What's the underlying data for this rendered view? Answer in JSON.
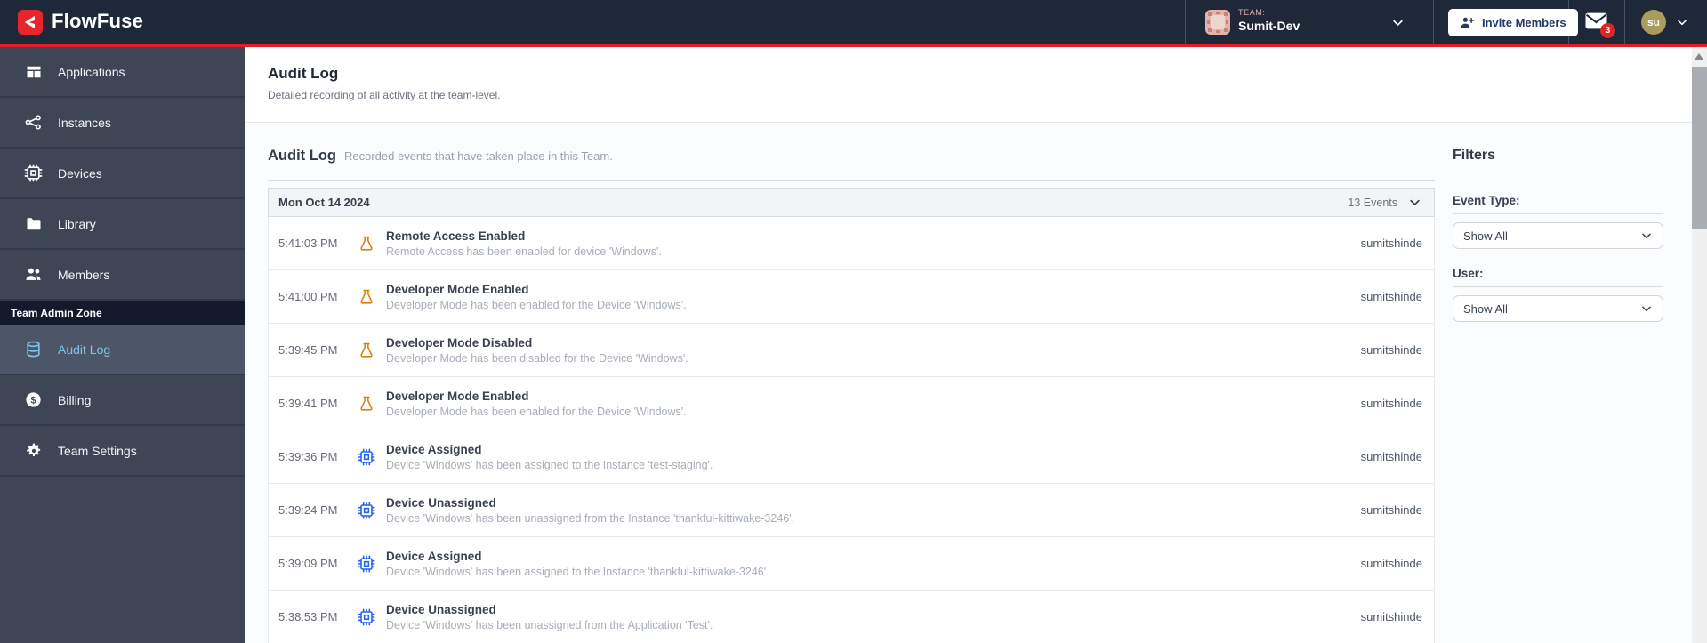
{
  "nav": {
    "brand": "FlowFuse",
    "team_eyebrow": "TEAM:",
    "team_name": "Sumit-Dev",
    "invite_button_label": "Invite Members",
    "mail_badge_count": "3",
    "user_initials": "su"
  },
  "sidebar": {
    "items": [
      {
        "label": "Applications",
        "icon": "applications-icon"
      },
      {
        "label": "Instances",
        "icon": "instances-icon"
      },
      {
        "label": "Devices",
        "icon": "devices-icon"
      },
      {
        "label": "Library",
        "icon": "library-icon"
      },
      {
        "label": "Members",
        "icon": "members-icon"
      }
    ],
    "admin_zone_label": "Team Admin Zone",
    "admin_items": [
      {
        "label": "Audit Log",
        "icon": "audit-log-icon",
        "active": true
      },
      {
        "label": "Billing",
        "icon": "billing-icon",
        "active": false
      },
      {
        "label": "Team Settings",
        "icon": "gear-icon",
        "active": false
      }
    ]
  },
  "page": {
    "title": "Audit Log",
    "subtitle": "Detailed recording of all activity at the team-level."
  },
  "section": {
    "title": "Audit Log",
    "subtitle": "Recorded events that have taken place in this Team."
  },
  "log_group": {
    "date": "Mon Oct 14 2024",
    "events_count": "13 Events"
  },
  "events": [
    {
      "time": "5:41:03 PM",
      "icon": "flask",
      "title": "Remote Access Enabled",
      "desc": "Remote Access has been enabled for device 'Windows'.",
      "user": "sumitshinde"
    },
    {
      "time": "5:41:00 PM",
      "icon": "flask",
      "title": "Developer Mode Enabled",
      "desc": "Developer Mode has been enabled for the Device 'Windows'.",
      "user": "sumitshinde"
    },
    {
      "time": "5:39:45 PM",
      "icon": "flask",
      "title": "Developer Mode Disabled",
      "desc": "Developer Mode has been disabled for the Device 'Windows'.",
      "user": "sumitshinde"
    },
    {
      "time": "5:39:41 PM",
      "icon": "flask",
      "title": "Developer Mode Enabled",
      "desc": "Developer Mode has been enabled for the Device 'Windows'.",
      "user": "sumitshinde"
    },
    {
      "time": "5:39:36 PM",
      "icon": "chip",
      "title": "Device Assigned",
      "desc": "Device 'Windows' has been assigned to the Instance 'test-staging'.",
      "user": "sumitshinde"
    },
    {
      "time": "5:39:24 PM",
      "icon": "chip",
      "title": "Device Unassigned",
      "desc": "Device 'Windows' has been unassigned from the Instance 'thankful-kittiwake-3246'.",
      "user": "sumitshinde"
    },
    {
      "time": "5:39:09 PM",
      "icon": "chip",
      "title": "Device Assigned",
      "desc": "Device 'Windows' has been assigned to the Instance 'thankful-kittiwake-3246'.",
      "user": "sumitshinde"
    },
    {
      "time": "5:38:53 PM",
      "icon": "chip",
      "title": "Device Unassigned",
      "desc": "Device 'Windows' has been unassigned from the Application 'Test'.",
      "user": "sumitshinde"
    }
  ],
  "filters": {
    "title": "Filters",
    "event_type_label": "Event Type:",
    "event_type_value": "Show All",
    "user_label": "User:",
    "user_value": "Show All"
  },
  "colors": {
    "accent_red": "#e21d25",
    "nav_bg": "#1f2838",
    "sidebar_bg": "#3e4656",
    "admin_zone_bg": "#121a2b",
    "active_item_bg": "#4d5669",
    "active_item_text": "#7fc3ea",
    "flask_icon": "#d9820b",
    "chip_icon": "#2563eb",
    "badge_red": "#dc2626",
    "user_avatar": "#a89d5b"
  }
}
